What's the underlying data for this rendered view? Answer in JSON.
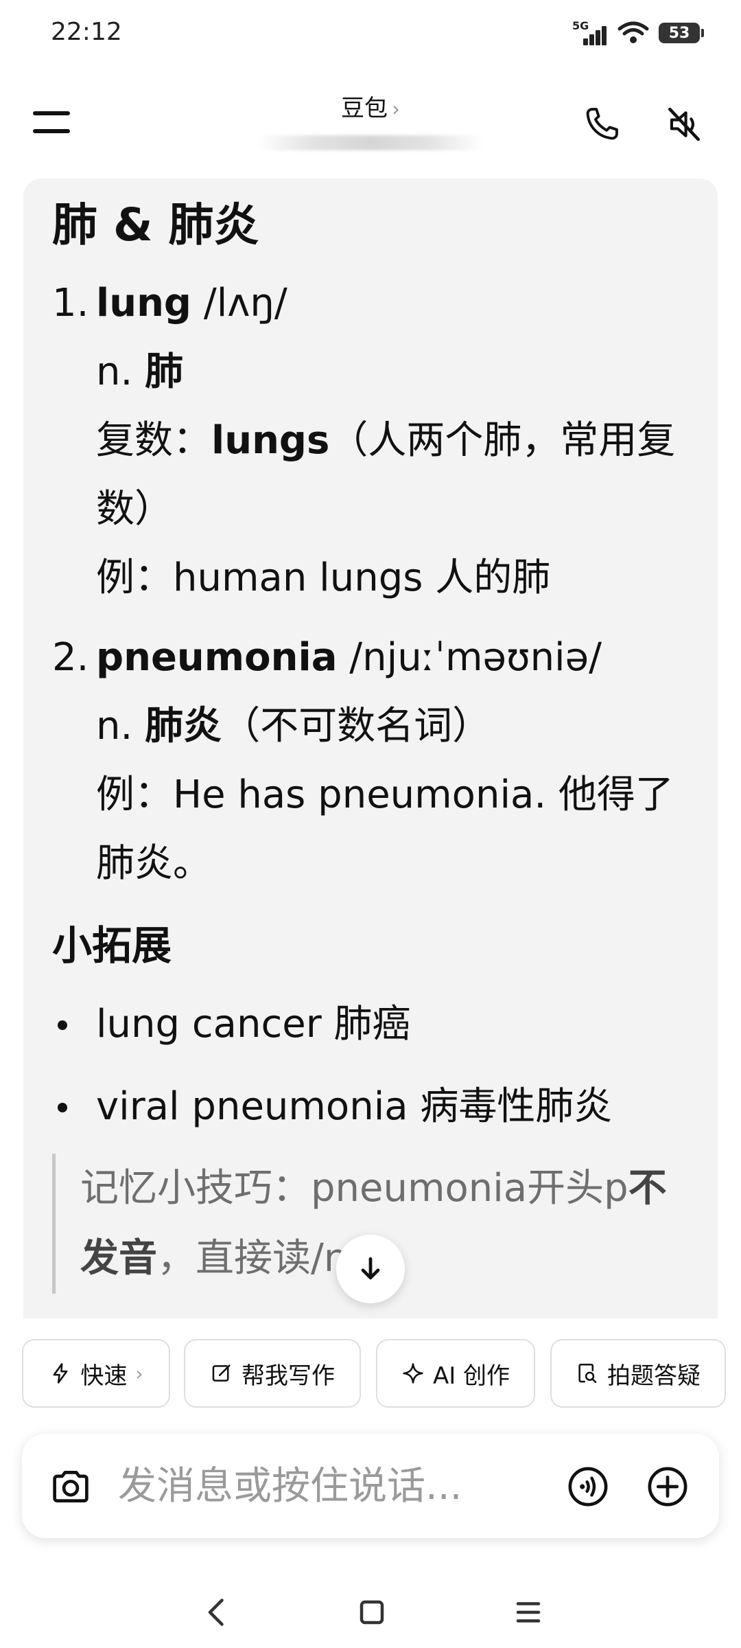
{
  "status_bar": {
    "time": "22:12",
    "network": "5G",
    "battery": "53"
  },
  "header": {
    "title": "豆包",
    "title_chevron": "›"
  },
  "content": {
    "heading": "肺 & 肺炎",
    "entries": [
      {
        "num": "1.",
        "word": "lung",
        "phonetic": "/lʌŋ/",
        "pos": "n.",
        "meaning": "肺",
        "plural_label": "复数：",
        "plural_word": "lungs",
        "plural_note": "（人两个肺，常用复数）",
        "example_label": "例：",
        "example": "human lungs 人的肺"
      },
      {
        "num": "2.",
        "word": "pneumonia",
        "phonetic": "/njuːˈməʊniə/",
        "pos": "n.",
        "meaning": "肺炎",
        "meaning_note": "（不可数名词）",
        "example_label": "例：",
        "example": "He has pneumonia. 他得了肺炎。"
      }
    ],
    "extension_heading": "小拓展",
    "bullets": [
      "lung cancer 肺癌",
      "viral pneumonia 病毒性肺炎"
    ],
    "tip": {
      "prefix": "记忆小技巧：pneumonia开头p",
      "bold": "不发音",
      "suffix": "，直接读/n/。"
    }
  },
  "chips": [
    {
      "label": "快速",
      "icon": "lightning-icon",
      "chevron": "›"
    },
    {
      "label": "帮我写作",
      "icon": "edit-icon"
    },
    {
      "label": "AI 创作",
      "icon": "sparkle-icon"
    },
    {
      "label": "拍题答疑",
      "icon": "search-doc-icon"
    }
  ],
  "input": {
    "placeholder": "发消息或按住说话..."
  }
}
